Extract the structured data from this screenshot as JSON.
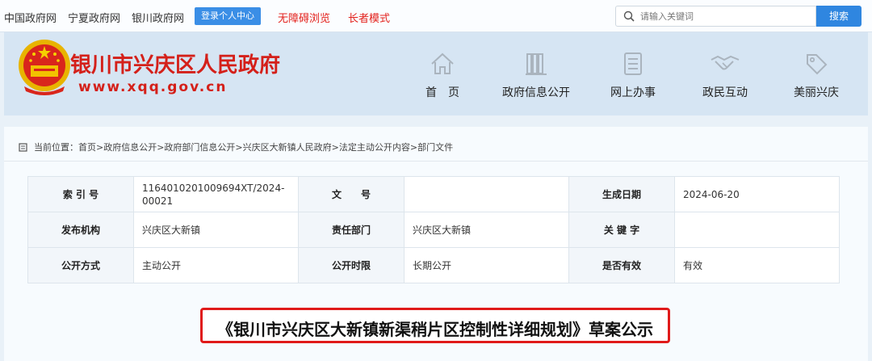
{
  "topbar": {
    "links": [
      "中国政府网",
      "宁夏政府网",
      "银川政府网"
    ],
    "login_label": "登录个人中心",
    "accessibility_label": "无障碍浏览",
    "elder_mode_label": "长者模式",
    "search_placeholder": "请输入关键词",
    "search_button": "搜索"
  },
  "header": {
    "site_name": "银川市兴庆区人民政府",
    "site_url": "www.xqq.gov.cn",
    "nav": [
      {
        "label": "首　页",
        "icon": "home-icon"
      },
      {
        "label": "政府信息公开",
        "icon": "books-icon"
      },
      {
        "label": "网上办事",
        "icon": "document-icon"
      },
      {
        "label": "政民互动",
        "icon": "handshake-icon"
      },
      {
        "label": "美丽兴庆",
        "icon": "tag-icon"
      }
    ]
  },
  "breadcrumb": {
    "text": "当前位置：首页>政府信息公开>政府部门信息公开>兴庆区大新镇人民政府>法定主动公开内容>部门文件"
  },
  "info": {
    "index_label": "索 引 号",
    "index_value": "1164010201009694XT/2024-00021",
    "doc_no_label": "文　　号",
    "doc_no_value": "",
    "date_label": "生成日期",
    "date_value": "2024-06-20",
    "publisher_label": "发布机构",
    "publisher_value": "兴庆区大新镇",
    "dept_label": "责任部门",
    "dept_value": "兴庆区大新镇",
    "keyword_label": "关 键 字",
    "keyword_value": "",
    "mode_label": "公开方式",
    "mode_value": "主动公开",
    "period_label": "公开时限",
    "period_value": "长期公开",
    "valid_label": "是否有效",
    "valid_value": "有效"
  },
  "document": {
    "title": "《银川市兴庆区大新镇新渠稍片区控制性详细规划》草案公示"
  },
  "colors": {
    "brand_red": "#d4201a",
    "button_blue": "#2f86e0",
    "header_bg": "#d6e5f3"
  }
}
